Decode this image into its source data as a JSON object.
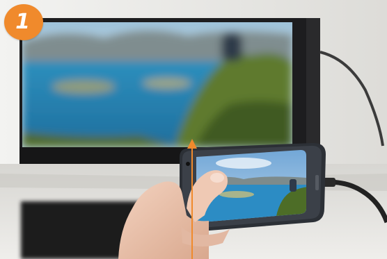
{
  "step": {
    "number": "1",
    "badge_color": "#f08a2c"
  },
  "photo": {
    "subject-icon": "hand-holding-smartphone-mirroring-to-tv",
    "arrow_color": "#f08a2c"
  }
}
